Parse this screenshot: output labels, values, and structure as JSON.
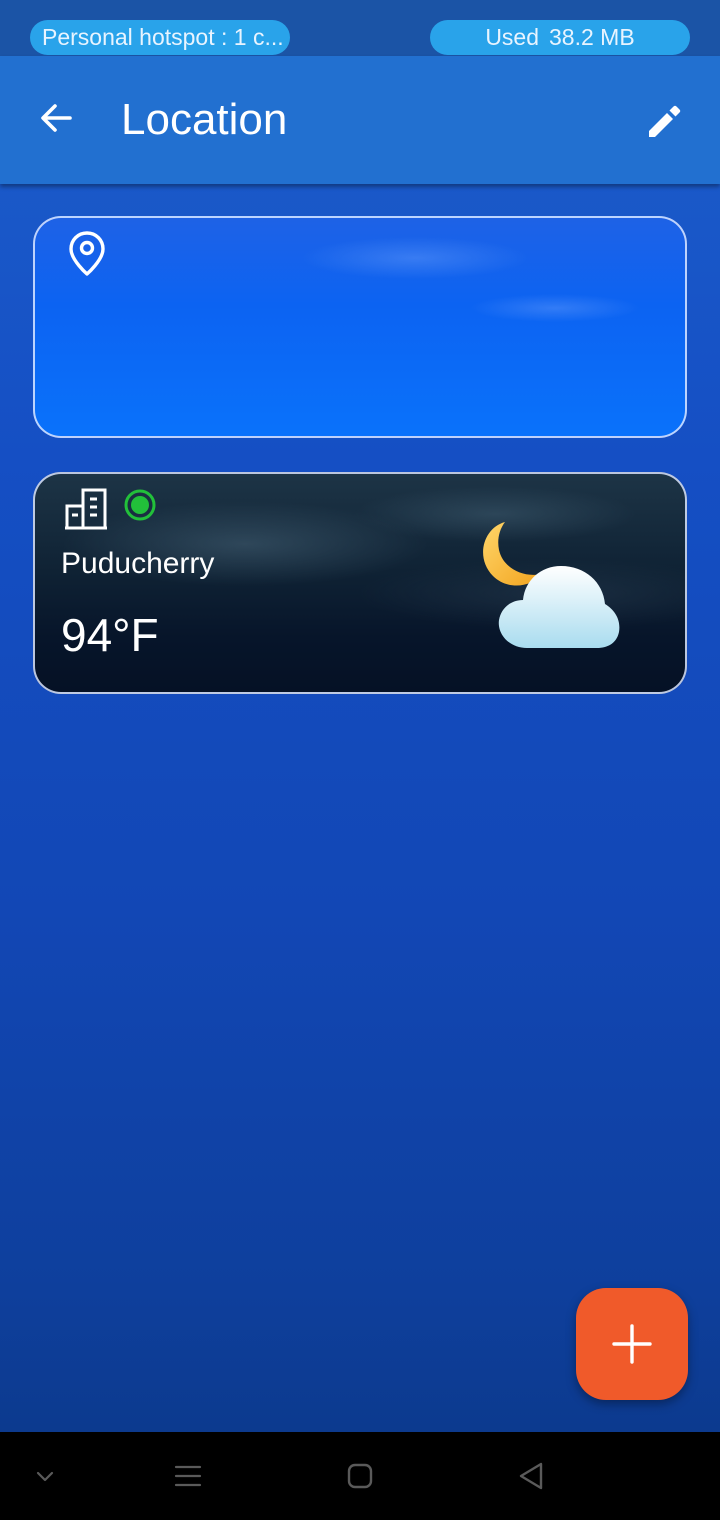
{
  "status_bar": {
    "hotspot_label": "Personal hotspot : 1 c...",
    "used_label": "Used",
    "used_value": "38.2 MB"
  },
  "app_bar": {
    "title": "Location",
    "back_icon": "arrow-left-icon",
    "edit_icon": "pencil-icon"
  },
  "location_card": {
    "icon": "map-pin-icon"
  },
  "city_card": {
    "icon": "building-icon",
    "current_indicator": "current-location-dot",
    "city": "Puducherry",
    "temperature": "94°F",
    "weather_icon": "partly-cloudy-night-icon"
  },
  "fab": {
    "icon": "plus-icon"
  },
  "nav_bar": {
    "icons": [
      "chevron-down-icon",
      "menu-icon",
      "home-icon",
      "back-triangle-icon"
    ]
  },
  "colors": {
    "app_bar": "#2270d0",
    "fab": "#f05a2a",
    "status_pill": "#29a3ea",
    "current_dot": "#22c03a"
  }
}
